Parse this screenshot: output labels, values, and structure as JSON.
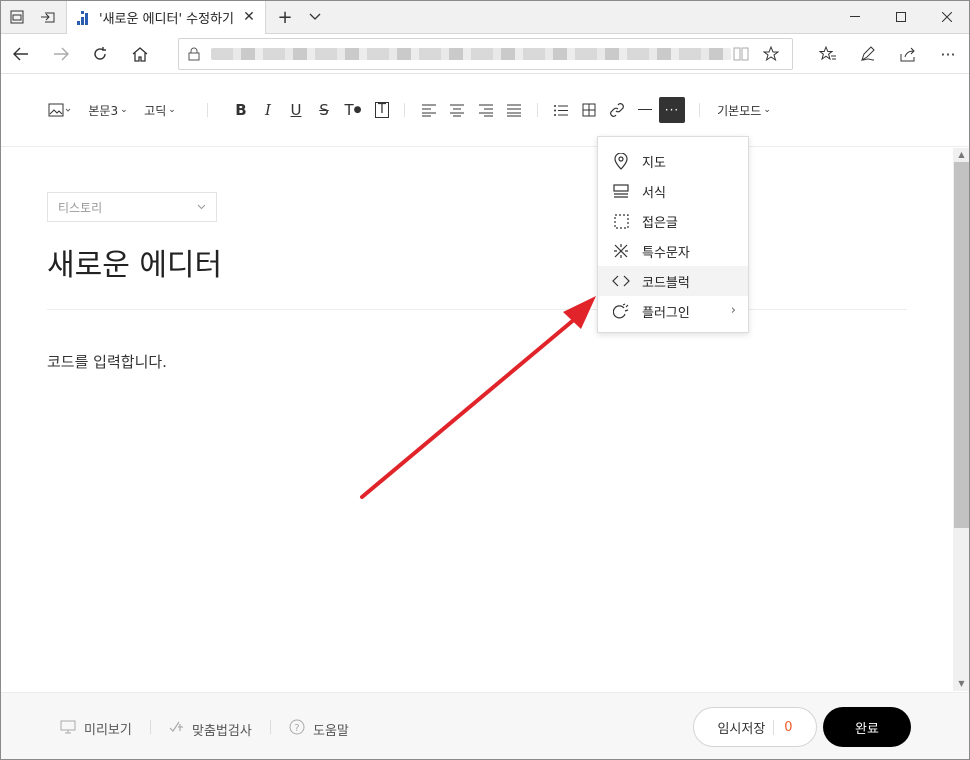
{
  "browser": {
    "tab_title": "'새로운 에디터' 수정하기",
    "url": "https://www.tistory.com/manage/newpost/?type=post&returnURL=..."
  },
  "toolbar": {
    "paragraph_style": "본문3",
    "font": "고딕",
    "mode": "기본모드",
    "more": "···",
    "bold": "B",
    "italic": "I",
    "underline": "U",
    "strike": "S",
    "textcolor": "T",
    "textbg": "T"
  },
  "editor": {
    "category": "티스토리",
    "title": "새로운 에디터",
    "body": "코드를 입력합니다."
  },
  "dropdown": {
    "items": [
      {
        "label": "지도",
        "icon": "map-pin-icon"
      },
      {
        "label": "서식",
        "icon": "template-icon"
      },
      {
        "label": "접은글",
        "icon": "fold-icon"
      },
      {
        "label": "특수문자",
        "icon": "special-char-icon"
      },
      {
        "label": "코드블럭",
        "icon": "code-icon"
      },
      {
        "label": "플러그인",
        "icon": "plugin-icon"
      }
    ]
  },
  "bottom": {
    "preview": "미리보기",
    "spellcheck": "맞춤법검사",
    "help": "도움말",
    "temp_save": "임시저장",
    "temp_count": "0",
    "done": "완료"
  },
  "colors": {
    "arrow": "#e0242a",
    "temp_count": "#f05a2a",
    "done_bg": "#000000"
  }
}
